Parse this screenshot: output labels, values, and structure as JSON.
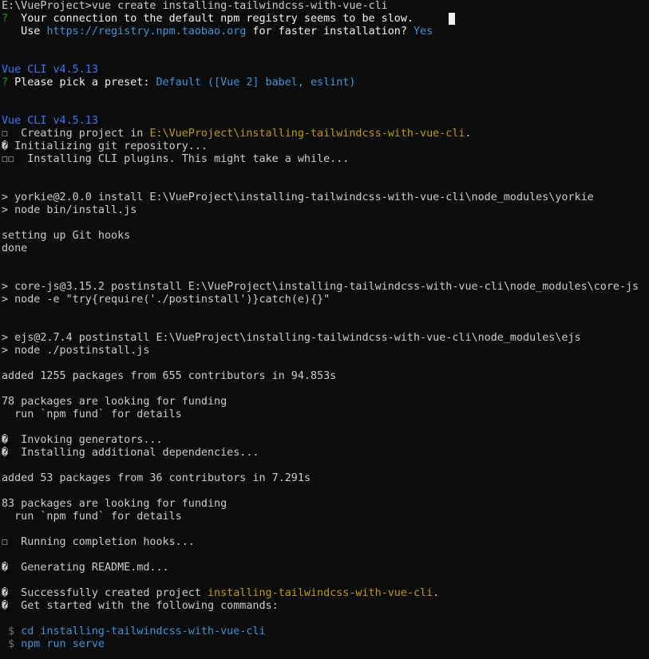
{
  "terminal": {
    "colors": {
      "background": "#0c0c0c",
      "foreground": "#cccccc",
      "green": "#13a10e",
      "yellow": "#c19c00",
      "blue": "#3b78ff",
      "cyan": "#3a96dd"
    },
    "lines": [
      [
        {
          "t": "E:\\VueProject>vue create installing-tailwindcss-with-vue-cli",
          "c": "c-white"
        }
      ],
      [
        {
          "t": "?",
          "c": "c-green"
        },
        {
          "t": "  Your connection to the default npm registry seems to be slow.",
          "c": "c-bright"
        }
      ],
      [
        {
          "t": "   Use ",
          "c": "c-bright"
        },
        {
          "t": "https://registry.npm.taobao.org",
          "c": "c-cyan"
        },
        {
          "t": " for faster installation? ",
          "c": "c-bright"
        },
        {
          "t": "Yes",
          "c": "c-cyan"
        }
      ],
      [],
      [],
      [
        {
          "t": "Vue CLI v4.5.13",
          "c": "c-blue"
        }
      ],
      [
        {
          "t": "?",
          "c": "c-green"
        },
        {
          "t": " Please pick a preset: ",
          "c": "c-bright"
        },
        {
          "t": "Default ([Vue 2] babel, eslint)",
          "c": "c-cyan"
        }
      ],
      [],
      [],
      [
        {
          "t": "Vue CLI v4.5.13",
          "c": "c-blue"
        }
      ],
      [
        {
          "t": "☐  Creating project in ",
          "c": "c-white"
        },
        {
          "t": "E:\\VueProject\\installing-tailwindcss-with-vue-cli",
          "c": "c-yellow"
        },
        {
          "t": ".",
          "c": "c-white"
        }
      ],
      [
        {
          "t": "� Initializing git repository...",
          "c": "c-white"
        }
      ],
      [
        {
          "t": "☐☐  Installing CLI plugins. This might take a while...",
          "c": "c-white"
        }
      ],
      [],
      [],
      [
        {
          "t": "> yorkie@2.0.0 install E:\\VueProject\\installing-tailwindcss-with-vue-cli\\node_modules\\yorkie",
          "c": "c-white"
        }
      ],
      [
        {
          "t": "> node bin/install.js",
          "c": "c-white"
        }
      ],
      [],
      [
        {
          "t": "setting up Git hooks",
          "c": "c-white"
        }
      ],
      [
        {
          "t": "done",
          "c": "c-white"
        }
      ],
      [],
      [],
      [
        {
          "t": "> core-js@3.15.2 postinstall E:\\VueProject\\installing-tailwindcss-with-vue-cli\\node_modules\\core-js",
          "c": "c-white"
        }
      ],
      [
        {
          "t": "> node -e \"try{require('./postinstall')}catch(e){}\"",
          "c": "c-white"
        }
      ],
      [],
      [],
      [
        {
          "t": "> ejs@2.7.4 postinstall E:\\VueProject\\installing-tailwindcss-with-vue-cli\\node_modules\\ejs",
          "c": "c-white"
        }
      ],
      [
        {
          "t": "> node ./postinstall.js",
          "c": "c-white"
        }
      ],
      [],
      [
        {
          "t": "added 1255 packages from 655 contributors in 94.853s",
          "c": "c-white"
        }
      ],
      [],
      [
        {
          "t": "78 packages are looking for funding",
          "c": "c-white"
        }
      ],
      [
        {
          "t": "  run `npm fund` for details",
          "c": "c-white"
        }
      ],
      [],
      [
        {
          "t": "�  Invoking generators...",
          "c": "c-white"
        }
      ],
      [
        {
          "t": "�  Installing additional dependencies...",
          "c": "c-white"
        }
      ],
      [],
      [
        {
          "t": "added 53 packages from 36 contributors in 7.291s",
          "c": "c-white"
        }
      ],
      [],
      [
        {
          "t": "83 packages are looking for funding",
          "c": "c-white"
        }
      ],
      [
        {
          "t": "  run `npm fund` for details",
          "c": "c-white"
        }
      ],
      [],
      [
        {
          "t": "☐  Running completion hooks...",
          "c": "c-white"
        }
      ],
      [],
      [
        {
          "t": "�  Generating README.md...",
          "c": "c-white"
        }
      ],
      [],
      [
        {
          "t": "�  Successfully created project ",
          "c": "c-white"
        },
        {
          "t": "installing-tailwindcss-with-vue-cli",
          "c": "c-yellow"
        },
        {
          "t": ".",
          "c": "c-white"
        }
      ],
      [
        {
          "t": "�  Get started with the following commands:",
          "c": "c-white"
        }
      ],
      [],
      [
        {
          "t": " $ ",
          "c": "c-gray"
        },
        {
          "t": "cd installing-tailwindcss-with-vue-cli",
          "c": "c-cyan"
        }
      ],
      [
        {
          "t": " $ ",
          "c": "c-gray"
        },
        {
          "t": "npm run serve",
          "c": "c-cyan"
        }
      ]
    ]
  }
}
